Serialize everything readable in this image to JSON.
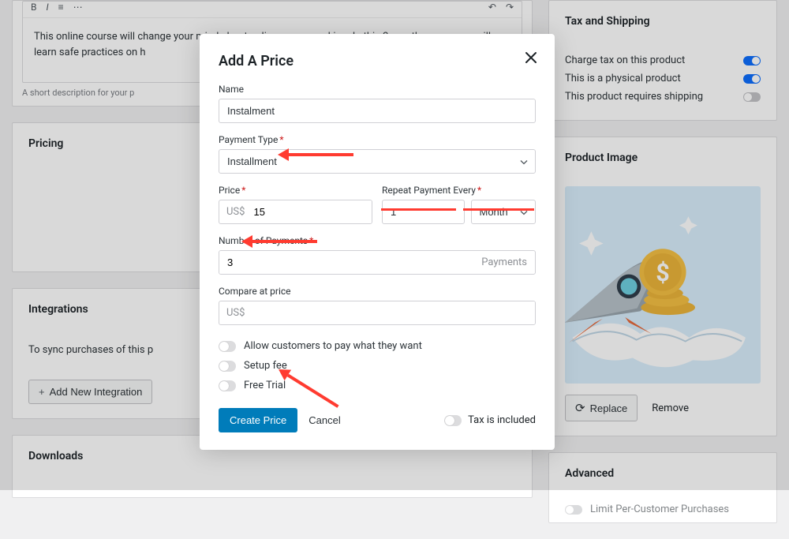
{
  "rte": {
    "content": "This online course will change your mind about online money making. In this 3 month course you will learn safe practices on h",
    "help": "A short description for your p"
  },
  "left": {
    "pricing_title": "Pricing",
    "integrations_title": "Integrations",
    "integrations_text": "To sync purchases of this p",
    "add_integration": "Add New Integration",
    "downloads_title": "Downloads"
  },
  "right": {
    "tax_title": "Tax and Shipping",
    "tax_row1": "Charge tax on this product",
    "tax_row2": "This is a physical product",
    "tax_row3": "This product requires shipping",
    "image_title": "Product Image",
    "replace": "Replace",
    "remove": "Remove",
    "advanced_title": "Advanced",
    "advanced_item": "Limit Per-Customer Purchases"
  },
  "modal": {
    "title": "Add A Price",
    "name_label": "Name",
    "name_value": "Instalment",
    "payment_type_label": "Payment Type",
    "payment_type_value": "Installment",
    "price_label": "Price",
    "price_currency": "US$",
    "price_value": "15",
    "repeat_label": "Repeat Payment Every",
    "repeat_num": "1",
    "repeat_unit": "Month",
    "num_payments_label": "Number of Payments",
    "num_payments_value": "3",
    "num_payments_suffix": "Payments",
    "compare_label": "Compare at price",
    "compare_currency": "US$",
    "opt_pay_what": "Allow customers to pay what they want",
    "opt_setup_fee": "Setup fee",
    "opt_free_trial": "Free Trial",
    "create_btn": "Create Price",
    "cancel_btn": "Cancel",
    "tax_included": "Tax is included"
  }
}
